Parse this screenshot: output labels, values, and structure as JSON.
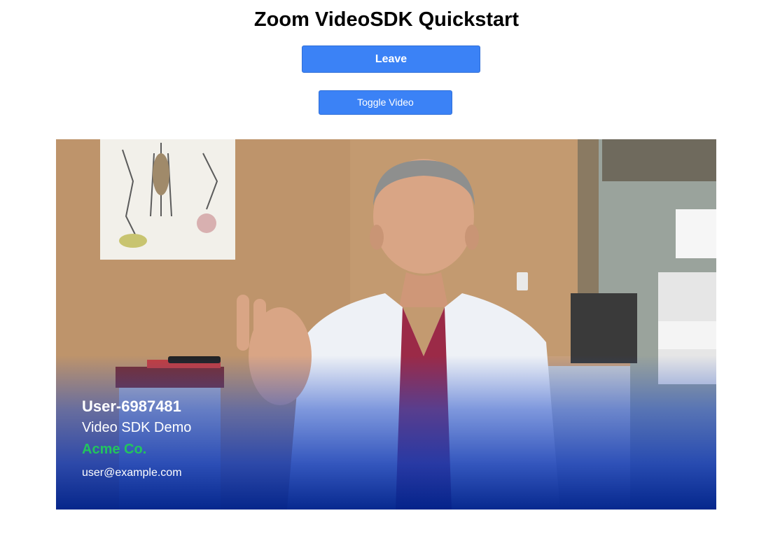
{
  "header": {
    "title": "Zoom VideoSDK Quickstart"
  },
  "controls": {
    "leave_label": "Leave",
    "toggle_video_label": "Toggle Video"
  },
  "video": {
    "participant": {
      "name": "User-6987481",
      "session_name": "Video SDK Demo",
      "company": "Acme Co.",
      "email": "user@example.com"
    }
  },
  "colors": {
    "button": "#3b82f6",
    "company_text": "#22c55e",
    "overlay": "#0a2f9e"
  },
  "icons": []
}
